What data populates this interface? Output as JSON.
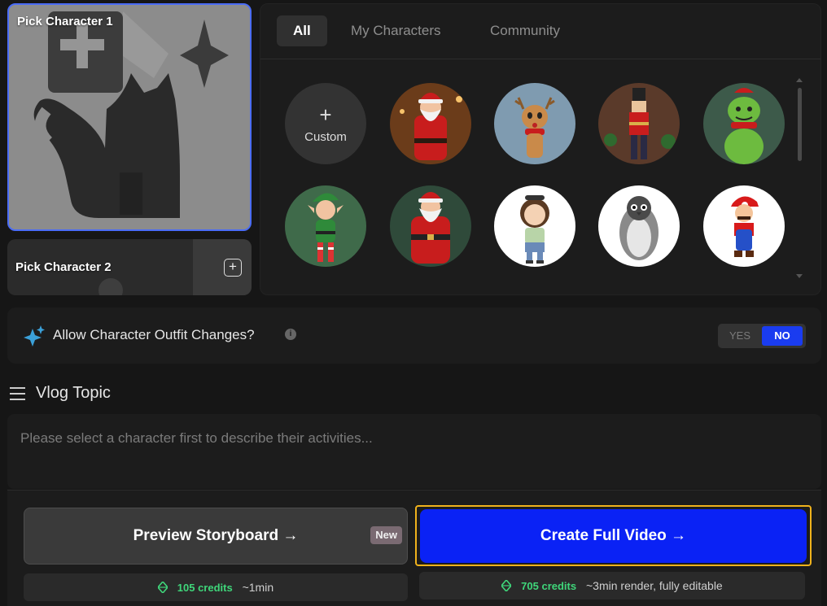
{
  "pickers": {
    "character_1": "Pick Character 1",
    "character_2": "Pick Character 2"
  },
  "tabs": [
    {
      "label": "All",
      "active": true
    },
    {
      "label": "My Characters",
      "active": false
    },
    {
      "label": "Community",
      "active": false
    }
  ],
  "gallery": {
    "custom_label": "Custom",
    "characters": [
      "santa-claus",
      "reindeer",
      "nutcracker",
      "grinch",
      "elf",
      "santa-claus-2",
      "girl",
      "penguin",
      "mario"
    ]
  },
  "outfit": {
    "question": "Allow Character Outfit Changes?",
    "yes_label": "YES",
    "no_label": "NO",
    "selected": "NO"
  },
  "vlog": {
    "title": "Vlog Topic",
    "placeholder": "Please select a character first to describe their activities..."
  },
  "actions": {
    "preview_label": "Preview Storyboard →",
    "new_badge": "New",
    "create_label": "Create Full Video →",
    "preview_credits": "105 credits",
    "preview_eta": "~1min",
    "create_credits": "705 credits",
    "create_eta": "~3min render, fully editable"
  },
  "colors": {
    "accent_blue": "#0a22f5",
    "highlight_border": "#f0b21c",
    "credit_green": "#3fd67a"
  }
}
